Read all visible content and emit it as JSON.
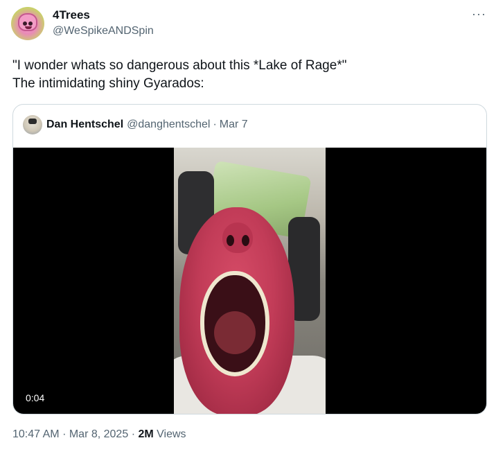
{
  "author": {
    "name": "4Trees",
    "handle": "@WeSpikeANDSpin"
  },
  "menu_glyph": "···",
  "tweet_text": "\"I wonder whats so dangerous about this *Lake of Rage*\"\nThe intimidating shiny Gyarados:",
  "quoted": {
    "name": "Dan Hentschel",
    "handle": "@danghentschel",
    "separator": "·",
    "date": "Mar 7",
    "video_time": "0:04"
  },
  "footer": {
    "time": "10:47 AM",
    "sep1": "·",
    "date": "Mar 8, 2025",
    "sep2": "·",
    "views_count": "2M",
    "views_label": "Views"
  },
  "icons": {
    "author_avatar": "avatar-image",
    "more": "more-options-icon",
    "quoted_avatar": "avatar-image"
  }
}
